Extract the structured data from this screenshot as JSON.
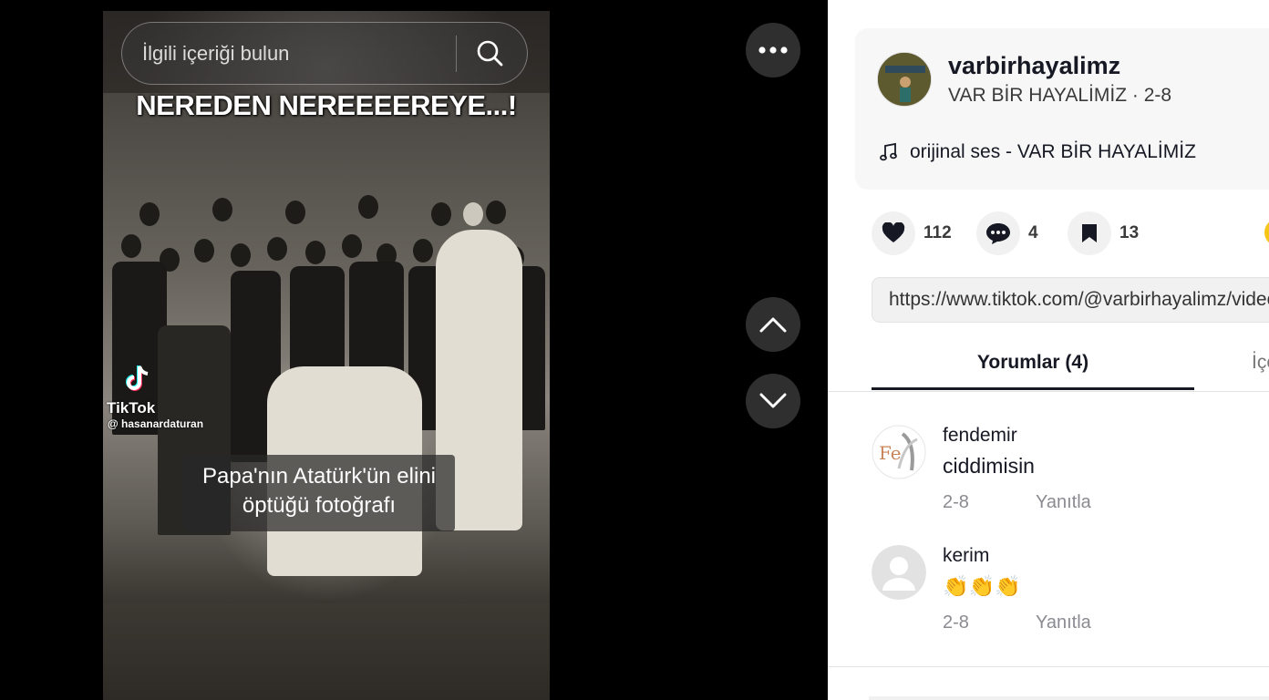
{
  "search": {
    "placeholder": "İlgili içeriği bulun"
  },
  "video": {
    "title_overlay": "NEREDEN NEREEEEREYE...!",
    "caption_line1": "Papa'nın Atatürk'ün elini",
    "caption_line2": "öptüğü fotoğrafı",
    "watermark": "TikTok",
    "watermark_user": "@ hasanardaturan"
  },
  "author": {
    "username": "varbirhayalimz",
    "meta": "VAR BİR HAYALİMİZ · 2-8",
    "music": "orijinal ses - VAR BİR HAYALİMİZ"
  },
  "actions": {
    "likes": "112",
    "comments": "4",
    "saves": "13"
  },
  "link": "https://www.tiktok.com/@varbirhayalimz/video/",
  "tabs": {
    "comments": "Yorumlar (4)",
    "creator": "İçe"
  },
  "comments": [
    {
      "user": "fendemir",
      "text": "ciddimisin",
      "date": "2-8",
      "reply": "Yanıtla"
    },
    {
      "user": "kerim",
      "text": "👏👏👏",
      "date": "2-8",
      "reply": "Yanıtla"
    }
  ],
  "colors": {
    "accent": "#161823",
    "panel_bg": "#f7f7f7",
    "muted": "#8a8b91"
  }
}
